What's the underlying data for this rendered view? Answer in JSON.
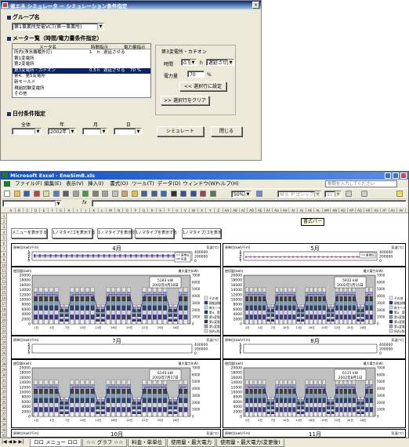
{
  "dialog": {
    "title": "省エネ シミュレータ － シミュレーション条件指定",
    "group_section": "グループ名",
    "group_value": "第1事業所受電VCT(第一事業所)",
    "meter_section": "メーター覧（時間/電力量条件指定）",
    "meter_columns": [
      "メータ名",
      "時間指示",
      "電力量指示"
    ],
    "meters": [
      {
        "name": "所内(浄水機履外灯)",
        "hours": "1",
        "unit": "h",
        "mode": "遅延させる",
        "power": "",
        "selected": false
      },
      {
        "name": "第1変電所",
        "hours": "",
        "unit": "",
        "mode": "",
        "power": "",
        "selected": false
      },
      {
        "name": "第2変電所",
        "hours": "",
        "unit": "",
        "mode": "",
        "power": "",
        "selected": false
      },
      {
        "name": "第3変電所・カチオン",
        "hours": "0.5",
        "unit": "h",
        "mode": "遅延させる",
        "power": "70 %",
        "selected": true
      },
      {
        "name": "第4、第5変電所",
        "hours": "",
        "unit": "",
        "mode": "",
        "power": "",
        "selected": false
      },
      {
        "name": "新モールド",
        "hours": "",
        "unit": "",
        "mode": "",
        "power": "",
        "selected": false
      },
      {
        "name": "現組試験変電所",
        "hours": "",
        "unit": "",
        "mode": "",
        "power": "",
        "selected": false
      },
      {
        "name": "その他",
        "hours": "",
        "unit": "",
        "mode": "",
        "power": "",
        "selected": false
      }
    ],
    "detail_title": "第3変電所・カチオン",
    "time_label": "時間",
    "time_value": "0.5",
    "time_unit": "h",
    "delay_value": "遅延させる",
    "power_label": "電力量",
    "power_value": "70",
    "power_unit": "%",
    "set_button": "<< 選択行に設定",
    "clear_button": ">> 選択行をクリア",
    "date_section": "日付条件指定",
    "date_headers": [
      "全体",
      "年",
      "月",
      "日"
    ],
    "year_value": "2002年",
    "simulate_button": "シミュレート",
    "close_button": "閉じる"
  },
  "excel": {
    "title": "Microsoft Excel - EneSimB.xls",
    "menu": [
      "ファイル(F)",
      "編集(E)",
      "表示(V)",
      "挿入(I)",
      "書式(O)",
      "ツール(T)",
      "データ(D)",
      "ウィンドウ(W)",
      "ヘルプ(H)"
    ],
    "help_placeholder": "質問を入力してください",
    "zoom": "50%",
    "font_name": "ＭＳ Ｐゴシック",
    "font_size": "11",
    "fx": "fx",
    "tooltip": "書式バー",
    "columns": [
      "A",
      "B",
      "C",
      "D",
      "E",
      "F",
      "G",
      "H",
      "I",
      "J",
      "K",
      "L",
      "M",
      "N",
      "O",
      "P",
      "Q",
      "R",
      "S",
      "T",
      "U",
      "V",
      "W",
      "X",
      "Y",
      "Z",
      "AA",
      "AB",
      "AC",
      "AD",
      "AE",
      "AF",
      "AG",
      "AH",
      "AI",
      "AJ",
      "AK",
      "AL",
      "AM",
      "AN",
      "AO",
      "AP",
      "AQ",
      "AR",
      "AS",
      "AT",
      "AU",
      "AV"
    ],
    "sheet_buttons": [
      "メニューを表示する",
      "1ノマタイ/ゴを表示する",
      "1ノマタイプを表示する",
      "1ノマタイプを表示する",
      "1ノマタイプ/ゴを表示"
    ],
    "tabs": [
      "ロロ メニュー ロロ",
      "☆☆ グラフ ☆☆",
      "料金・単単位",
      "使用量・最大電力",
      "使用量・最大電力(変更後)"
    ],
    "colors": {
      "accent": "#0a246a",
      "dialog_bg": "#ece9d8",
      "excel_title": "#0a4fc8"
    }
  },
  "chart_data": [
    {
      "type": "line",
      "title": "4月",
      "ylabel": "原単位(kwh/千m)",
      "y2label": "気温(℃)",
      "series": [
        {
          "name": "原単位",
          "values": [
            2,
            2,
            2,
            2,
            2,
            2,
            2,
            2,
            2,
            2,
            2,
            2,
            2,
            2,
            2,
            2,
            2,
            2,
            2,
            2,
            2,
            2,
            2,
            2,
            2,
            2,
            2,
            2,
            2,
            2
          ]
        },
        {
          "name": "気温",
          "values": [
            3,
            3,
            3,
            3,
            3,
            3,
            3,
            3,
            3,
            3,
            3,
            3,
            3,
            3,
            3,
            3,
            3,
            3,
            3,
            3,
            3,
            3,
            3,
            3,
            3,
            3,
            3,
            3,
            3,
            3
          ]
        }
      ],
      "ylim": [
        0,
        5
      ],
      "y2lim": [
        0,
        400000
      ],
      "y2ticks": [
        0,
        200000,
        400000
      ]
    },
    {
      "type": "line",
      "title": "5月",
      "ylabel": "原単位(kwh/千m)",
      "y2label": "気温(℃)",
      "series": [
        {
          "name": "原単位",
          "values": [
            2,
            2,
            2,
            2,
            2,
            2,
            2,
            2,
            2,
            2,
            2,
            2,
            2,
            2,
            2,
            2,
            2,
            2,
            2,
            2,
            2,
            2,
            2,
            2,
            2,
            2,
            2,
            2,
            2,
            2,
            2
          ]
        }
      ],
      "ylim": [
        0,
        5
      ],
      "y2lim": [
        0,
        400000
      ],
      "y2ticks": [
        0,
        200000,
        400000
      ]
    },
    {
      "type": "bar",
      "title": "",
      "ylabel": "使用量(kwh)",
      "y2label": "最大電力(kW)",
      "annotation": [
        "5183 kW",
        "2002年4月18日"
      ],
      "yticks": [
        0,
        2000,
        4000,
        6000,
        8000,
        10000,
        12000,
        14000,
        16000,
        18000,
        20000
      ],
      "y2ticks": [
        0,
        1000,
        2000,
        3000,
        4000,
        5000,
        6000,
        7000
      ],
      "legend": [
        "その他",
        "現組試験",
        "新モールド",
        "第4、第5",
        "第3変電所",
        "第2変電所",
        "第1変電所",
        "所内(浄水機)"
      ]
    },
    {
      "type": "bar",
      "title": "",
      "ylabel": "使用量(kwh)",
      "y2label": "最大電力(kW)",
      "annotation": [
        "5932 kW",
        "2002年5月15日"
      ],
      "yticks": [
        0,
        2000,
        4000,
        6000,
        8000,
        10000,
        12000,
        14000,
        16000,
        18000,
        20000
      ],
      "y2ticks": [
        0,
        1000,
        2000,
        3000,
        4000,
        5000,
        6000,
        7000
      ],
      "legend": [
        "その他",
        "現組試験",
        "新モールド",
        "第4、第5",
        "第3変電所",
        "第2変電所",
        "第1変電所",
        "所内(浄水機)"
      ]
    },
    {
      "type": "line",
      "title": "7月",
      "ylabel": "原単位(kwh/千m)",
      "y2label": "気温(℃)",
      "ylim": [
        0,
        5
      ],
      "y2lim": [
        0,
        400000
      ],
      "y2ticks": [
        0,
        200000,
        400000
      ]
    },
    {
      "type": "line",
      "title": "8月",
      "ylabel": "原単位(kwh/千m)",
      "y2label": "気温(℃)",
      "ylim": [
        0,
        5
      ],
      "y2lim": [
        0,
        400000
      ],
      "y2ticks": [
        0,
        200000,
        400000
      ]
    },
    {
      "type": "bar",
      "title": "",
      "ylabel": "使用量(kwh)",
      "y2label": "最大電力(kW)",
      "annotation": [
        "6140 kW",
        "2002年7月17日"
      ],
      "yticks": [
        0,
        2000,
        4000,
        6000,
        8000,
        10000,
        12000,
        14000,
        16000,
        18000,
        20000
      ],
      "y2ticks": [
        0,
        1000,
        2000,
        3000,
        4000,
        5000,
        6000,
        7000
      ]
    },
    {
      "type": "bar",
      "title": "",
      "ylabel": "使用量(kwh)",
      "y2label": "最大電力(kW)",
      "annotation": [
        "6115 kW",
        "2002年8月1日"
      ],
      "yticks": [
        0,
        2000,
        4000,
        6000,
        8000,
        10000,
        12000,
        14000,
        16000,
        18000,
        20000
      ],
      "y2ticks": [
        0,
        1000,
        2000,
        3000,
        4000,
        5000,
        6000,
        7000
      ]
    },
    {
      "type": "line",
      "title": "10月",
      "ylabel": "原単位(kwh/千m)",
      "y2label": "気温(℃)"
    },
    {
      "type": "line",
      "title": "11月",
      "ylabel": "原単位(kwh/千m)",
      "y2label": "気温(℃)"
    }
  ]
}
